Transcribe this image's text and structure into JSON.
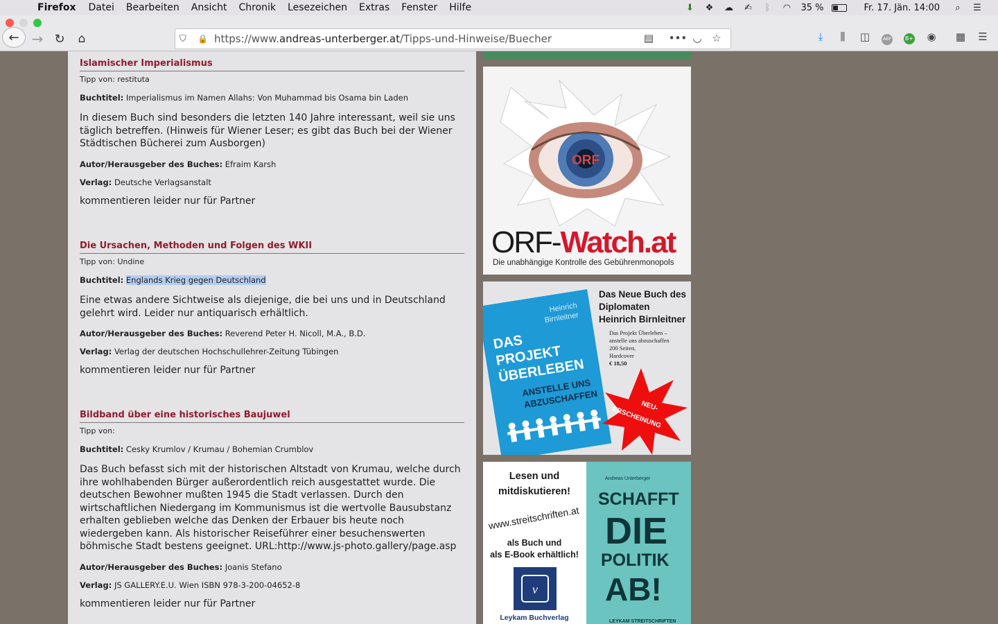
{
  "menubar": {
    "app": "Firefox",
    "menus": [
      "Datei",
      "Bearbeiten",
      "Ansicht",
      "Chronik",
      "Lesezeichen",
      "Extras",
      "Fenster",
      "Hilfe"
    ],
    "battery": "35 %",
    "clock": "Fr. 17. Jän.  14:00"
  },
  "browser": {
    "url_prefix": "https://www.",
    "url_host": "andreas-unterberger.at",
    "url_path": "/Tipps-und-Hinweise/Buecher"
  },
  "entries": [
    {
      "title": "Islamischer Imperialismus",
      "tipp": "Tipp von: restituta",
      "booktitle_label": "Buchtitel:",
      "booktitle": "Imperialismus im Namen Allahs: Von Muhammad bis Osama bin Laden",
      "description": "In diesem Buch sind besonders die letzten 140 Jahre interessant, weil sie uns täglich betreffen. (Hinweis für Wiener Leser; es gibt das Buch bei der Wiener Städtischen Bücherei zum Ausborgen)",
      "author_label": "Autor/Herausgeber des Buches:",
      "author": "Efraim Karsh",
      "publisher_label": "Verlag:",
      "publisher": "Deutsche Verlagsanstalt",
      "comment": "kommentieren leider nur für Partner"
    },
    {
      "title": "Die Ursachen, Methoden und Folgen des WKII",
      "tipp": "Tipp von: Undine",
      "booktitle_label": "Buchtitel:",
      "booktitle": "Englands Krieg gegen Deutschland",
      "description": "Eine etwas andere Sichtweise als diejenige, die bei uns und in Deutschland gelehrt wird. Leider nur antiquarisch erhältlich.",
      "author_label": "Autor/Herausgeber des Buches:",
      "author": "Reverend Peter H. Nicoll, M.A., B.D.",
      "publisher_label": "Verlag:",
      "publisher": "Verlag der deutschen Hochschullehrer-Zeitung Tübingen",
      "comment": "kommentieren leider nur für Partner"
    },
    {
      "title": "Bildband über eine historisches Baujuwel",
      "tipp": "Tipp von:",
      "booktitle_label": "Buchtitel:",
      "booktitle": "Cesky Krumlov / Krumau / Bohemian Crumblov",
      "description": "Das Buch befasst sich mit der historischen Altstadt von Krumau, welche durch ihre wohlhabenden Bürger außerordentlich reich ausgestattet wurde. Die deutschen Bewohner mußten 1945 die Stadt verlassen. Durch den wirtschaftlichen Niedergang im Kommunismus ist die wertvolle Bausubstanz erhalten geblieben welche das Denken der Erbauer bis heute noch wiedergeben kann. Als historischer Reiseführer einer besuchenswerten böhmische Stadt bestens geeignet. URL:http://www.js-photo.gallery/page.asp",
      "author_label": "Autor/Herausgeber des Buches:",
      "author": "Joanis Stefano",
      "publisher_label": "Verlag:",
      "publisher": "JS GALLERY.E.U. Wien ISBN 978-3-200-04652-8",
      "comment": "kommentieren leider nur für Partner"
    }
  ],
  "ads": {
    "orf": {
      "eye_text": "ORF",
      "brand_dark": "ORF-",
      "brand_red": "Watch.at",
      "tagline": "Die unabhängige Kontrolle des Gebührenmonopols"
    },
    "birnleitner": {
      "head1": "Das Neue Buch des",
      "head2": "Diplomaten",
      "head3": "Heinrich Birnleitner",
      "info1": "Das Projekt Überleben –",
      "info2": "anstelle uns abzuschaffen",
      "info3": "200 Seiten,",
      "info4": "Hardcover",
      "price": "€ 18,50",
      "cover_author1": "Heinrich",
      "cover_author2": "Birnleitner",
      "cover_t1": "DAS",
      "cover_t2": "PROJEKT",
      "cover_t3": "ÜBERLEBEN",
      "cover_s1": "ANSTELLE UNS",
      "cover_s2": "ABZUSCHAFFEN",
      "burst1": "NEU-",
      "burst2": "ERSCHEINUNG"
    },
    "streit": {
      "l1": "Lesen und",
      "l2": "mitdiskutieren!",
      "url": "www.streitschriften.at",
      "l3": "als Buch und",
      "l4": "als E-Book erhältlich!",
      "publisher": "Leykam Buchverlag",
      "cover_author": "Andreas Unterberger",
      "cover_t1": "SCHAFFT",
      "cover_t2": "DIE",
      "cover_t3": "POLITIK",
      "cover_t4": "AB!",
      "cover_series": "LEYKAM STREITSCHRIFTEN"
    }
  }
}
